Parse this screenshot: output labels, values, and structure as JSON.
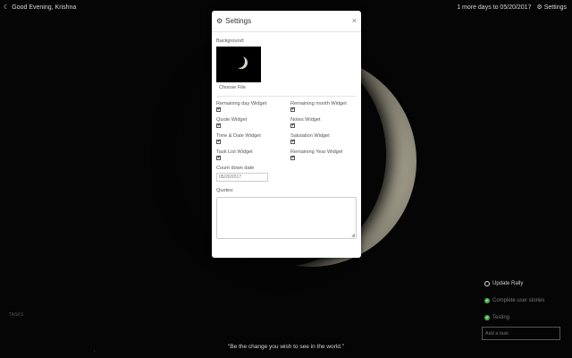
{
  "topbar": {
    "greeting": "Good Evening, Krishna",
    "countdown_text": "1 more days to 05/20/2017",
    "settings_label": "Settings"
  },
  "settings_modal": {
    "title": "Settings",
    "close_glyph": "×",
    "background_label": "Background:",
    "choose_file_label": "Choose File",
    "widgets": [
      {
        "label": "Remaining day Widget",
        "checked": true
      },
      {
        "label": "Remaining month Widget",
        "checked": true
      },
      {
        "label": "Quote Widget",
        "checked": true
      },
      {
        "label": "Notes Widget",
        "checked": true
      },
      {
        "label": "Time & Date Widget",
        "checked": true
      },
      {
        "label": "Salutation Widget",
        "checked": true
      },
      {
        "label": "Task List Widget",
        "checked": true
      },
      {
        "label": "Remaining Year Widget",
        "checked": true
      }
    ],
    "checkmark": "✔",
    "countdown_label": "Count down date",
    "countdown_placeholder": "05/20/2017",
    "quotes_label": "Quotes:",
    "quotes_value": ""
  },
  "todos": {
    "items": [
      {
        "text": "Update Rally",
        "done": false
      },
      {
        "text": "Complete user stories",
        "done": true
      },
      {
        "text": "Testing",
        "done": true
      }
    ],
    "check_glyph": "✔",
    "add_placeholder": "Add a task"
  },
  "footer": {
    "left_label": "TASKS",
    "quote": "\"Be the change you wish to see in the world.\""
  },
  "icons": {
    "greeting_icon": "moon-icon",
    "settings_icon": "gear-icon"
  }
}
